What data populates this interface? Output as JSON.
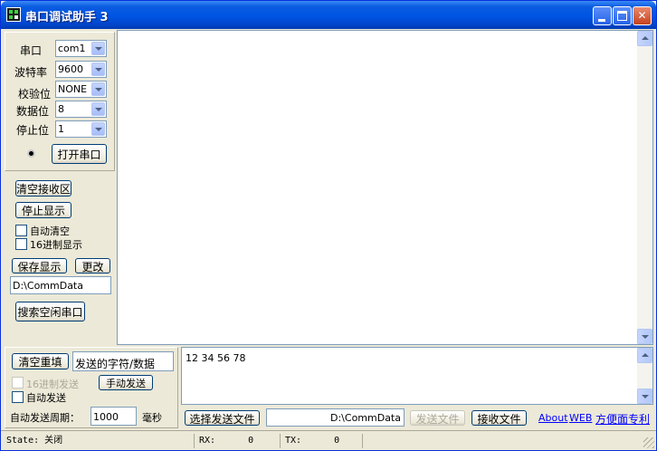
{
  "window": {
    "title": "串口调试助手 3"
  },
  "serial": {
    "port_label": "串口",
    "port_value": "com1",
    "baud_label": "波特率",
    "baud_value": "9600",
    "parity_label": "校验位",
    "parity_value": "NONE",
    "databits_label": "数据位",
    "databits_value": "8",
    "stopbits_label": "停止位",
    "stopbits_value": "1",
    "open_button": "打开串口"
  },
  "receive": {
    "clear_button": "清空接收区",
    "stop_button": "停止显示",
    "auto_clear_label": "自动清空",
    "hex_display_label": "16进制显示",
    "save_button": "保存显示",
    "change_button": "更改",
    "path_value": "D:\\CommData",
    "search_button": "搜索空闲串口"
  },
  "send": {
    "clear_button": "清空重填",
    "hint_value": "发送的字符/数据",
    "hex_send_label": "16进制发送",
    "manual_send_button": "手动发送",
    "auto_send_label": "自动发送",
    "period_label": "自动发送周期：",
    "period_value": "1000",
    "period_unit": "毫秒",
    "content": "12 34 56 78",
    "choose_file_button": "选择发送文件",
    "file_path": "D:\\CommData",
    "send_file_button": "发送文件",
    "recv_file_button": "接收文件"
  },
  "links": {
    "about": "About",
    "web": "WEB",
    "patent": "方便面专利"
  },
  "status": {
    "state_label": "State:",
    "state_value": "关闭",
    "rx_label": "RX:",
    "rx_value": "0",
    "tx_label": "TX:",
    "tx_value": "0"
  },
  "colors": {
    "titlebar": "#0054e3",
    "face": "#ece9d8",
    "link": "#0000ff"
  }
}
